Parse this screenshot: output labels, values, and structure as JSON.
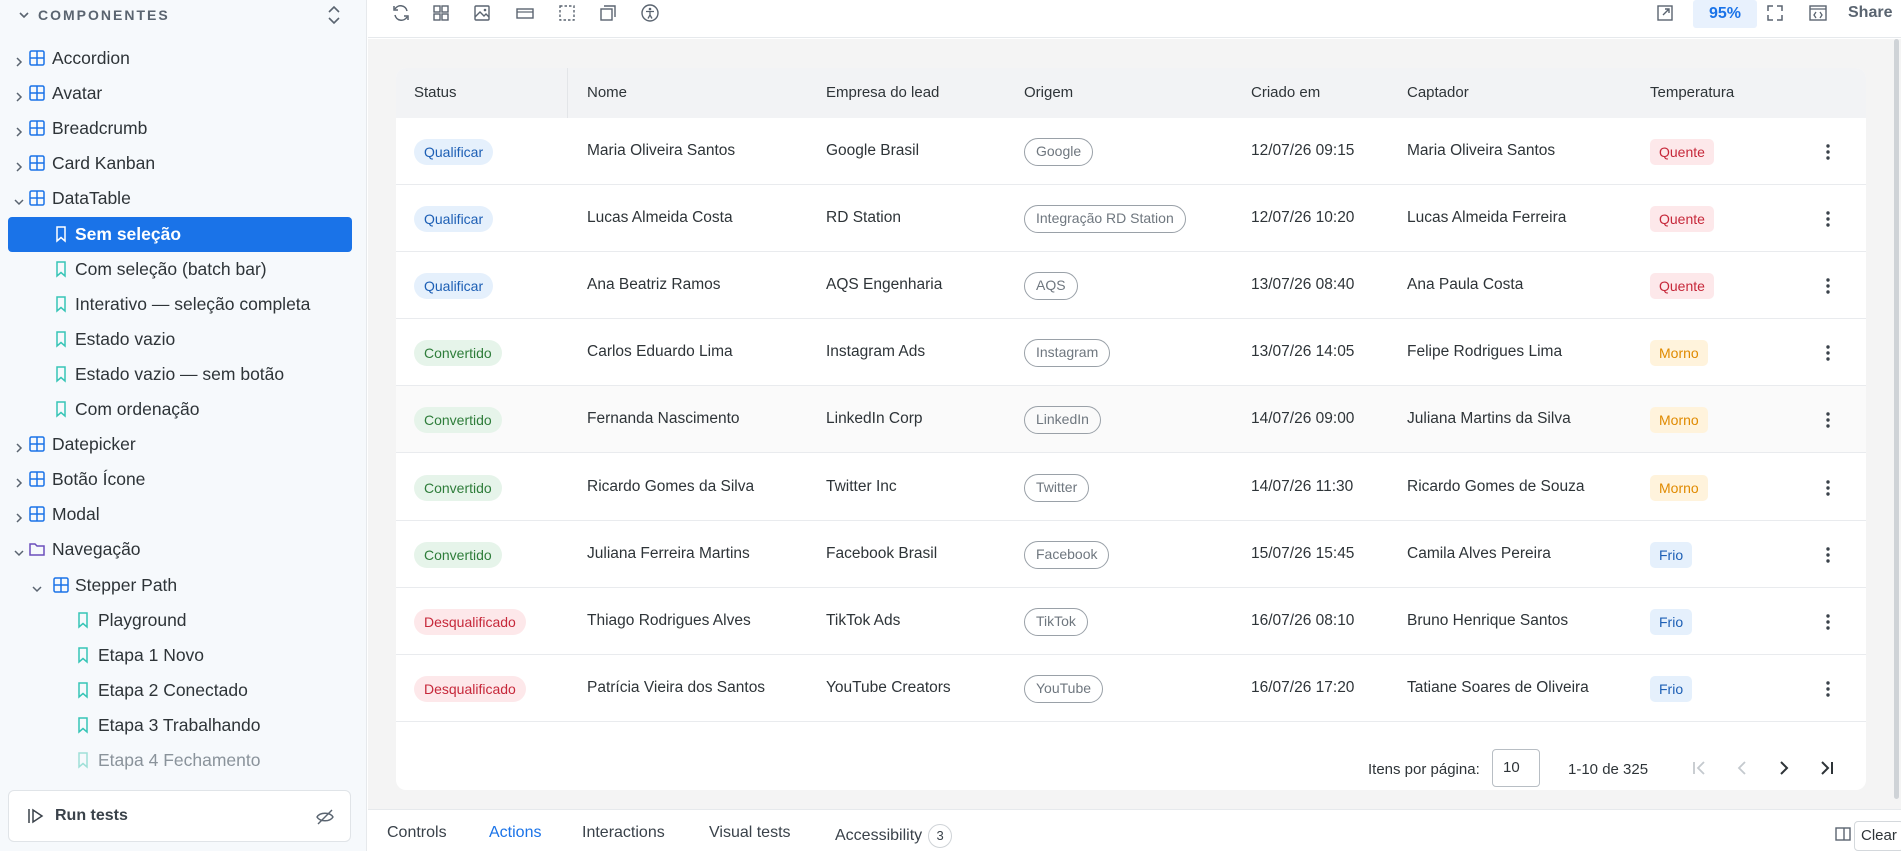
{
  "sidebar": {
    "title": "COMPONENTES",
    "items": [
      {
        "label": "Accordion",
        "kind": "component",
        "expandable": true,
        "expanded": false,
        "depth": 0
      },
      {
        "label": "Avatar",
        "kind": "component",
        "expandable": true,
        "expanded": false,
        "depth": 0
      },
      {
        "label": "Breadcrumb",
        "kind": "component",
        "expandable": true,
        "expanded": false,
        "depth": 0
      },
      {
        "label": "Card Kanban",
        "kind": "component",
        "expandable": true,
        "expanded": false,
        "depth": 0
      },
      {
        "label": "DataTable",
        "kind": "component",
        "expandable": true,
        "expanded": true,
        "depth": 0
      },
      {
        "label": "Sem seleção",
        "kind": "story",
        "depth": 1,
        "selected": true
      },
      {
        "label": "Com seleção (batch bar)",
        "kind": "story",
        "depth": 1
      },
      {
        "label": "Interativo — seleção completa",
        "kind": "story",
        "depth": 1
      },
      {
        "label": "Estado vazio",
        "kind": "story",
        "depth": 1
      },
      {
        "label": "Estado vazio — sem botão",
        "kind": "story",
        "depth": 1
      },
      {
        "label": "Com ordenação",
        "kind": "story",
        "depth": 1
      },
      {
        "label": "Datepicker",
        "kind": "component",
        "expandable": true,
        "expanded": false,
        "depth": 0
      },
      {
        "label": "Botão Ícone",
        "kind": "component",
        "expandable": true,
        "expanded": false,
        "depth": 0
      },
      {
        "label": "Modal",
        "kind": "component",
        "expandable": true,
        "expanded": false,
        "depth": 0
      },
      {
        "label": "Navegação",
        "kind": "folder",
        "expandable": true,
        "expanded": true,
        "depth": 0
      },
      {
        "label": "Stepper Path",
        "kind": "component",
        "expandable": true,
        "expanded": true,
        "depth": 1
      },
      {
        "label": "Playground",
        "kind": "story",
        "depth": 2
      },
      {
        "label": "Etapa 1 Novo",
        "kind": "story",
        "depth": 2
      },
      {
        "label": "Etapa 2 Conectado",
        "kind": "story",
        "depth": 2
      },
      {
        "label": "Etapa 3 Trabalhando",
        "kind": "story",
        "depth": 2
      },
      {
        "label": "Etapa 4 Fechamento",
        "kind": "story",
        "depth": 2,
        "faded": true
      }
    ],
    "run_tests_label": "Run tests"
  },
  "toolbar": {
    "icons": [
      "remount-icon",
      "grid-icon",
      "background-icon",
      "measure-icon",
      "outline-icon",
      "viewport-icon",
      "accessibility-icon"
    ],
    "zoom": "95%",
    "share_label": "Share"
  },
  "table": {
    "headers": [
      "Status",
      "Nome",
      "Empresa do lead",
      "Origem",
      "Criado em",
      "Captador",
      "Temperatura"
    ],
    "rows": [
      {
        "status": "Qualificar",
        "status_kind": "blue",
        "nome": "Maria Oliveira Santos",
        "empresa": "Google Brasil",
        "origem": "Google",
        "criado": "12/07/26 09:15",
        "captador": "Maria Oliveira Santos",
        "temperatura": "Quente",
        "temp_kind": "hot"
      },
      {
        "status": "Qualificar",
        "status_kind": "blue",
        "nome": "Lucas Almeida Costa",
        "empresa": "RD Station",
        "origem": "Integração RD Station",
        "criado": "12/07/26 10:20",
        "captador": "Lucas Almeida Ferreira",
        "temperatura": "Quente",
        "temp_kind": "hot"
      },
      {
        "status": "Qualificar",
        "status_kind": "blue",
        "nome": "Ana Beatriz Ramos",
        "empresa": "AQS Engenharia",
        "origem": "AQS",
        "criado": "13/07/26 08:40",
        "captador": "Ana Paula Costa",
        "temperatura": "Quente",
        "temp_kind": "hot"
      },
      {
        "status": "Convertido",
        "status_kind": "green",
        "nome": "Carlos Eduardo Lima",
        "empresa": "Instagram Ads",
        "origem": "Instagram",
        "criado": "13/07/26 14:05",
        "captador": "Felipe Rodrigues Lima",
        "temperatura": "Morno",
        "temp_kind": "warm"
      },
      {
        "status": "Convertido",
        "status_kind": "green",
        "nome": "Fernanda Nascimento",
        "empresa": "LinkedIn Corp",
        "origem": "LinkedIn",
        "criado": "14/07/26 09:00",
        "captador": "Juliana Martins da Silva",
        "temperatura": "Morno",
        "temp_kind": "warm"
      },
      {
        "status": "Convertido",
        "status_kind": "green",
        "nome": "Ricardo Gomes da Silva",
        "empresa": "Twitter Inc",
        "origem": "Twitter",
        "criado": "14/07/26 11:30",
        "captador": "Ricardo Gomes de Souza",
        "temperatura": "Morno",
        "temp_kind": "warm"
      },
      {
        "status": "Convertido",
        "status_kind": "green",
        "nome": "Juliana Ferreira Martins",
        "empresa": "Facebook Brasil",
        "origem": "Facebook",
        "criado": "15/07/26 15:45",
        "captador": "Camila Alves Pereira",
        "temperatura": "Frio",
        "temp_kind": "cold"
      },
      {
        "status": "Desqualificado",
        "status_kind": "red",
        "nome": "Thiago Rodrigues Alves",
        "empresa": "TikTok Ads",
        "origem": "TikTok",
        "criado": "16/07/26 08:10",
        "captador": "Bruno Henrique Santos",
        "temperatura": "Frio",
        "temp_kind": "cold"
      },
      {
        "status": "Desqualificado",
        "status_kind": "red",
        "nome": "Patrícia Vieira dos Santos",
        "empresa": "YouTube Creators",
        "origem": "YouTube",
        "criado": "16/07/26 17:20",
        "captador": "Tatiane Soares de Oliveira",
        "temperatura": "Frio",
        "temp_kind": "cold"
      }
    ]
  },
  "pagination": {
    "items_per_page_label": "Itens por página:",
    "items_per_page": "10",
    "range": "1-10 de 325"
  },
  "panel": {
    "tabs": [
      "Controls",
      "Actions",
      "Interactions",
      "Visual tests",
      "Accessibility"
    ],
    "active_tab": "Actions",
    "accessibility_count": "3",
    "clear_label": "Clear"
  },
  "colors": {
    "accent": "#1a73e8",
    "status_blue": "#e5f0fc",
    "status_green": "#e6f4ea",
    "status_red": "#fde8ea",
    "temp_hot": "#fde8ea",
    "temp_warm": "#fff3dc",
    "temp_cold": "#e5f0fc"
  }
}
